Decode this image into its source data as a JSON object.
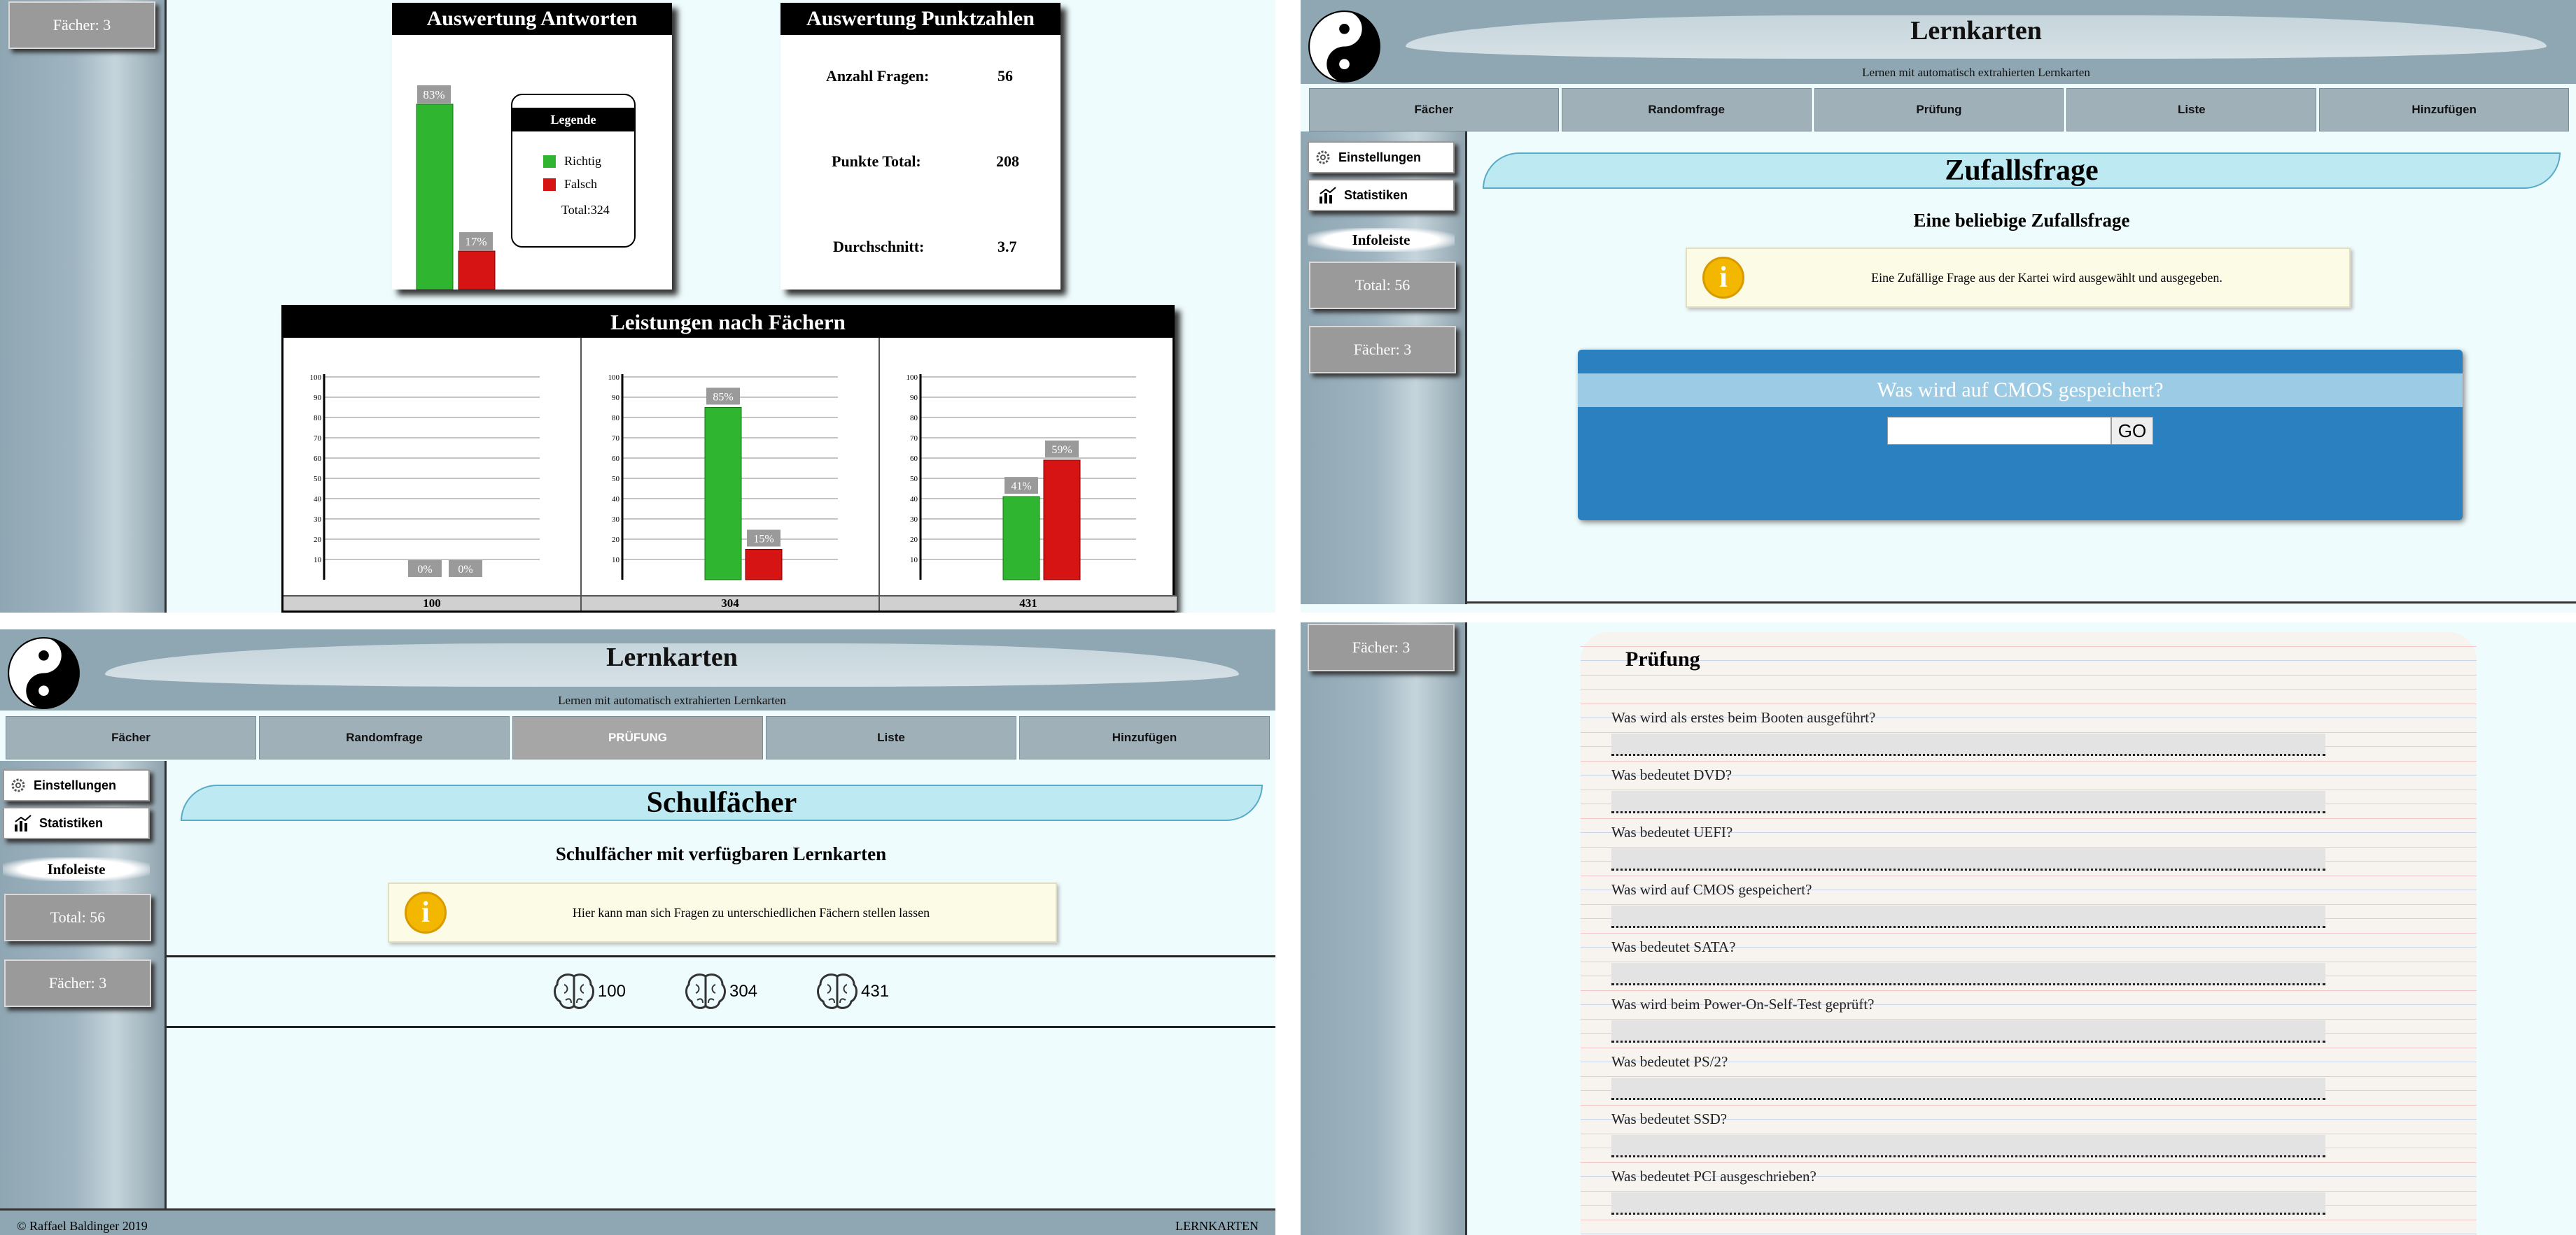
{
  "q1": {
    "sidebar_faecher": "Fächer: 3",
    "answers_panel": {
      "title": "Auswertung Antworten",
      "correct_pct": 83,
      "wrong_pct": 17,
      "correct_label": "83%",
      "wrong_label": "17%",
      "legend_title": "Legende",
      "legend_correct": "Richtig",
      "legend_wrong": "Falsch",
      "legend_total": "Total:324"
    },
    "points_panel": {
      "title": "Auswertung Punktzahlen",
      "rows": [
        {
          "label": "Anzahl Fragen:",
          "value": "56"
        },
        {
          "label": "Punkte Total:",
          "value": "208"
        },
        {
          "label": "Durchschnitt:",
          "value": "3.7"
        }
      ]
    },
    "subjects_panel": {
      "title": "Leistungen nach Fächern"
    }
  },
  "chart_data": [
    {
      "type": "bar",
      "categories": [
        "Richtig",
        "Falsch"
      ],
      "values": [
        83,
        17
      ],
      "title": "Auswertung Antworten",
      "ylim": [
        0,
        100
      ]
    },
    {
      "type": "bar",
      "title": "Leistungen nach Fächern",
      "groups": [
        {
          "name": "100",
          "series": [
            {
              "name": "Richtig",
              "values": [
                0
              ]
            },
            {
              "name": "Falsch",
              "values": [
                0
              ]
            }
          ],
          "labels": [
            "0%",
            "0%"
          ]
        },
        {
          "name": "304",
          "series": [
            {
              "name": "Richtig",
              "values": [
                85
              ]
            },
            {
              "name": "Falsch",
              "values": [
                15
              ]
            }
          ],
          "labels": [
            "85%",
            "15%"
          ]
        },
        {
          "name": "431",
          "series": [
            {
              "name": "Richtig",
              "values": [
                41
              ]
            },
            {
              "name": "Falsch",
              "values": [
                59
              ]
            }
          ],
          "labels": [
            "41%",
            "59%"
          ]
        }
      ],
      "yticks": [
        10,
        20,
        30,
        40,
        50,
        60,
        70,
        80,
        90,
        100
      ],
      "ylim": [
        0,
        100
      ],
      "grid": true
    }
  ],
  "app": {
    "title": "Lernkarten",
    "subtitle": "Lernen mit automatisch extrahierten Lernkarten",
    "nav": [
      "Fächer",
      "Randomfrage",
      "Prüfung",
      "Liste",
      "Hinzufügen"
    ],
    "nav_active_q3": "PRÜFUNG",
    "settings": "Einstellungen",
    "stats": "Statistiken",
    "infoleiste": "Infoleiste",
    "total": "Total: 56",
    "faecher": "Fächer: 3",
    "accent": "#2b80bf"
  },
  "q2": {
    "banner": "Zufallsfrage",
    "subhead": "Eine beliebige Zufallsfrage",
    "info": "Eine Zufällige Frage aus der Kartei wird ausgewählt und ausgegeben.",
    "question": "Was wird auf CMOS gespeichert?",
    "answer_value": "",
    "go": "GO"
  },
  "q3": {
    "banner": "Schulfächer",
    "subhead": "Schulfächer mit verfügbaren Lernkarten",
    "info": "Hier kann man sich Fragen zu unterschiedlichen Fächern stellen lassen",
    "subjects": [
      "100",
      "304",
      "431"
    ],
    "footer_left": "© Raffael Baldinger 2019",
    "footer_right": "LERNKARTEN"
  },
  "q4": {
    "sidebar_faecher": "Fächer: 3",
    "title": "Prüfung",
    "questions": [
      "Was wird als erstes beim Booten ausgeführt?",
      "Was bedeutet DVD?",
      "Was bedeutet UEFI?",
      "Was wird auf CMOS gespeichert?",
      "Was bedeutet SATA?",
      "Was wird beim Power-On-Self-Test geprüft?",
      "Was bedeutet PS/2?",
      "Was bedeutet SSD?",
      "Was bedeutet PCI ausgeschrieben?"
    ]
  }
}
